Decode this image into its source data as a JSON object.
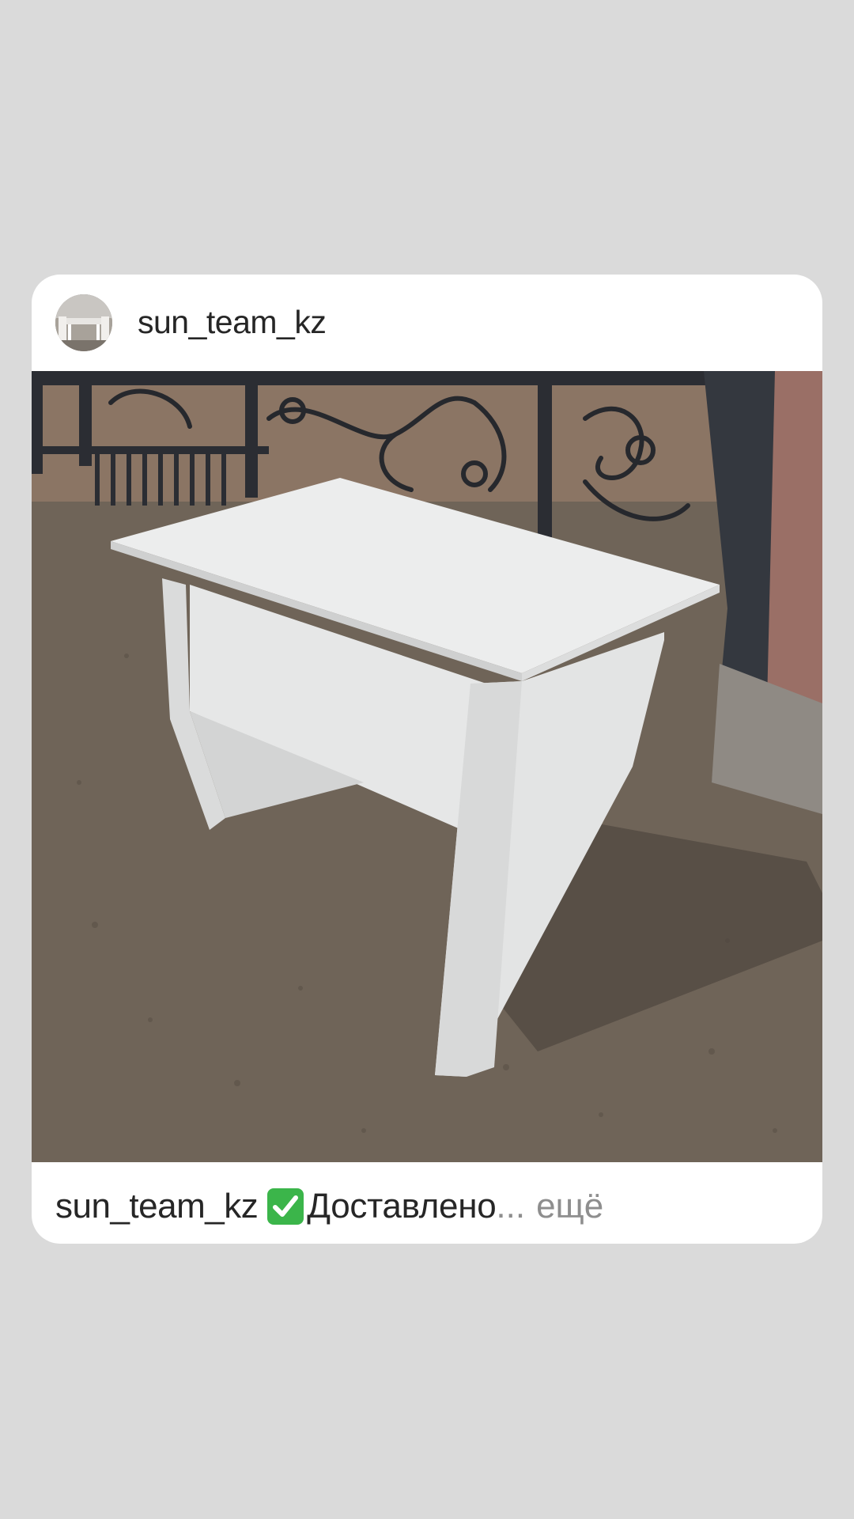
{
  "post": {
    "username": "sun_team_kz",
    "caption": {
      "username": "sun_team_kz",
      "icon": "green-check-emoji-icon",
      "text": "Доставлено",
      "ellipsis": "...",
      "more_label": "ещё"
    }
  },
  "colors": {
    "background": "#dadada",
    "card": "#ffffff",
    "text": "#262626",
    "muted": "#8e8e8e",
    "check": "#3bb54a"
  }
}
